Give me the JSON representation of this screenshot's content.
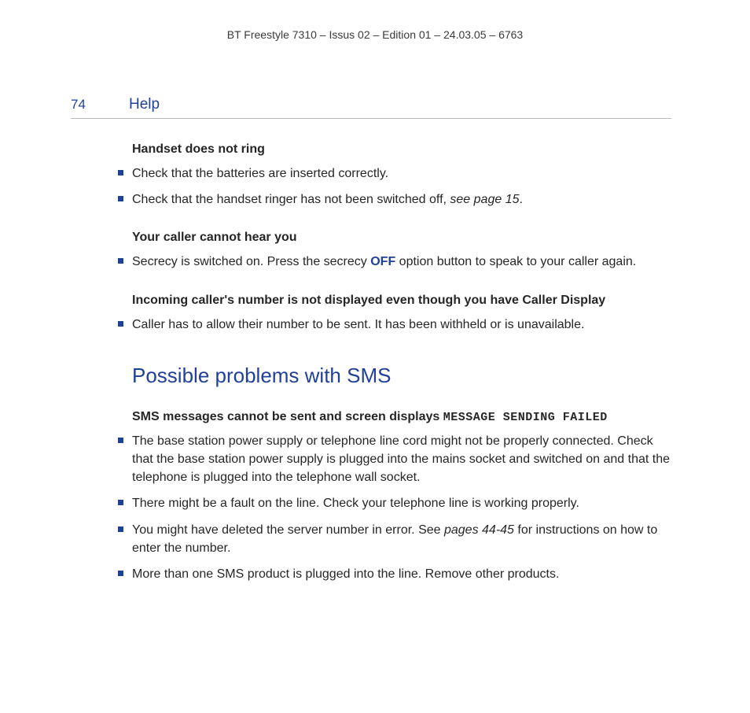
{
  "docHeader": "BT Freestyle 7310 – Issus 02 – Edition 01 – 24.03.05 – 6763",
  "pageNumber": "74",
  "sectionTitle": "Help",
  "blocks": {
    "h1": "Handset does not ring",
    "h1_items": {
      "a": "Check that the batteries are inserted correctly.",
      "b_pre": "Check that the handset ringer has not been switched off, ",
      "b_ital": "see page 15",
      "b_post": "."
    },
    "h2": "Your caller cannot hear you",
    "h2_items": {
      "a_pre": "Secrecy is switched on. Press the secrecy ",
      "a_off": "OFF",
      "a_post": " option button to speak to your caller again."
    },
    "h3": "Incoming caller's number is not displayed even though you have Caller Display",
    "h3_items": {
      "a": "Caller has to allow their number to be sent. It has been withheld or is unavailable."
    },
    "smsHeading": "Possible problems with SMS",
    "sms_sub_pre": "SMS messages cannot be sent and screen displays ",
    "sms_sub_lcd": "MESSAGE SENDING FAILED",
    "sms_items": {
      "a": "The base station power supply or telephone line cord might not be properly connected. Check that the base station power supply is plugged into the mains socket and switched on and that the telephone is plugged into the telephone wall socket.",
      "b": "There might be a fault on the line. Check your telephone line is working properly.",
      "c_pre": "You might have deleted the server number in error. See ",
      "c_ital": "pages 44-45",
      "c_post": " for instructions on how to enter the number.",
      "d": "More than one SMS product is plugged into the line. Remove other products."
    }
  }
}
